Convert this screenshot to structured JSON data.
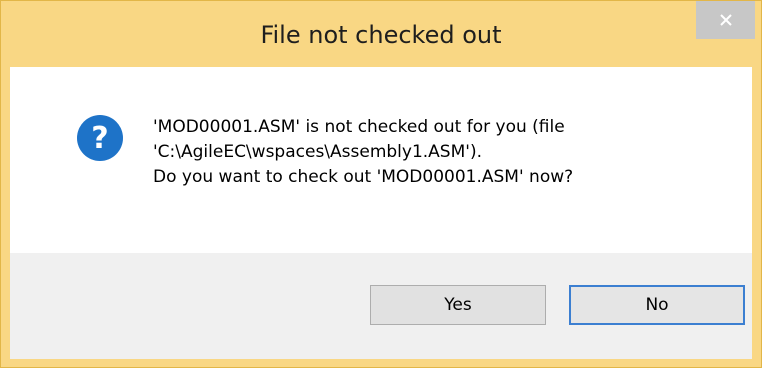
{
  "dialog": {
    "title": "File not checked out",
    "icon": "question-icon",
    "message_lines": [
      "'MOD00001.ASM' is not checked out for you (file",
      "'C:\\AgileEC\\wspaces\\Assembly1.ASM').",
      "Do you want to check out 'MOD00001.ASM' now?"
    ],
    "buttons": {
      "yes_label": "Yes",
      "no_label": "No"
    }
  },
  "colors": {
    "frame": "#f9d784",
    "close_button": "#c7c7c7",
    "icon": "#1e73c8",
    "default_button_border": "#3c7fd1",
    "button_area": "#f0f0f0"
  }
}
